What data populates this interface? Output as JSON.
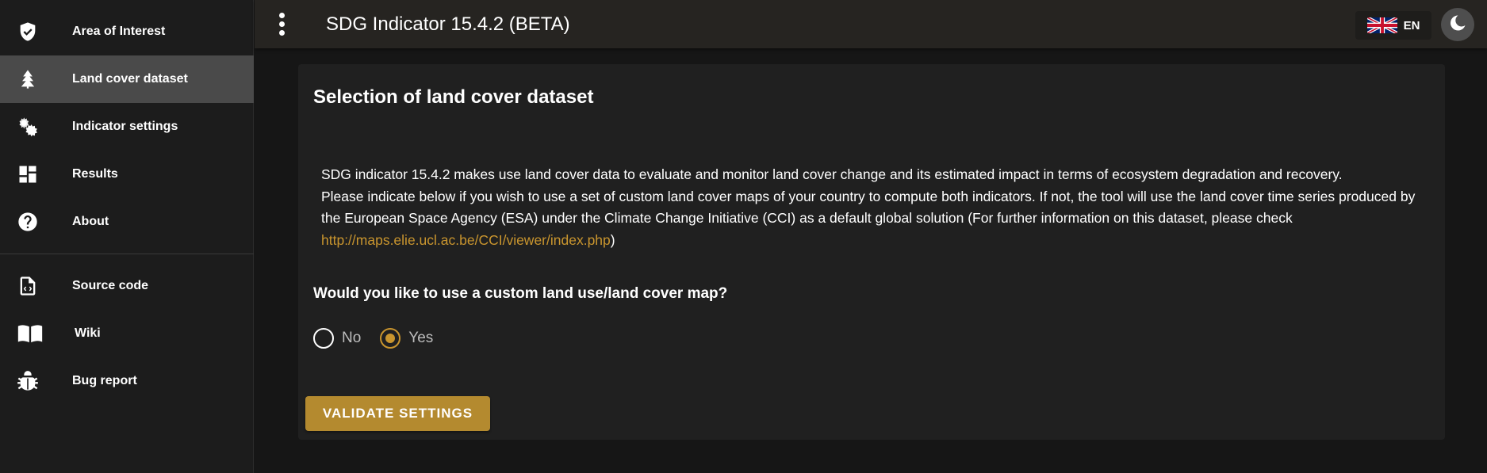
{
  "sidebar": {
    "items": [
      {
        "label": "Area of Interest",
        "icon": "shield-check-icon"
      },
      {
        "label": "Land cover dataset",
        "icon": "tree-icon",
        "active": true
      },
      {
        "label": "Indicator settings",
        "icon": "gears-icon"
      },
      {
        "label": "Results",
        "icon": "dashboard-icon"
      },
      {
        "label": "About",
        "icon": "help-circle-icon"
      }
    ],
    "links": [
      {
        "label": "Source code",
        "icon": "code-file-icon"
      },
      {
        "label": "Wiki",
        "icon": "book-icon"
      },
      {
        "label": "Bug report",
        "icon": "bug-icon"
      }
    ]
  },
  "header": {
    "title": "SDG Indicator 15.4.2 (BETA)",
    "language": "EN"
  },
  "main": {
    "title": "Selection of land cover dataset",
    "description_line1": "SDG indicator 15.4.2 makes use land cover data to evaluate and monitor land cover change and its estimated impact in terms of ecosystem degradation and recovery.",
    "description_line2": "Please indicate below if you wish to use a set of custom land cover maps of your country to compute both indicators. If not, the tool will use the land cover time series produced by the European Space Agency (ESA) under the Climate Change Initiative (CCI) as a default global solution (For further information on this dataset, please check ",
    "description_link": "http://maps.elie.ucl.ac.be/CCI/viewer/index.php",
    "description_end": ")",
    "question": "Would you like to use a custom land use/land cover map?",
    "options": [
      {
        "label": "No",
        "selected": false
      },
      {
        "label": "Yes",
        "selected": true
      }
    ],
    "validate_label": "VALIDATE SETTINGS"
  },
  "colors": {
    "accent": "#c9952e",
    "button": "#b48a2f",
    "background": "#161616",
    "card": "#202020",
    "header": "#262421",
    "sidebar_active": "#4a4a4a"
  }
}
